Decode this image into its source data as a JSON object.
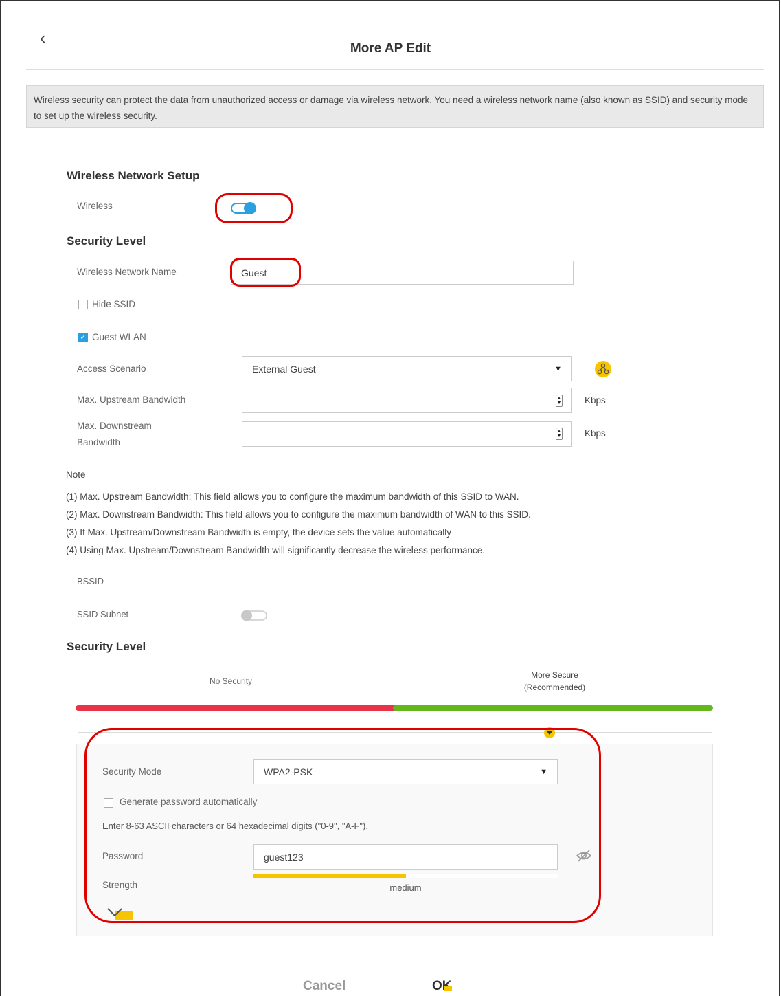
{
  "page": {
    "title": "More AP Edit",
    "back_icon": "chevron-left-icon",
    "info": "Wireless security can protect the data from unauthorized access or damage via wireless network. You need a wireless network name (also known as SSID) and security mode to set up the wireless security."
  },
  "setup": {
    "heading": "Wireless Network Setup",
    "wireless_label": "Wireless",
    "wireless_on": true
  },
  "security1": {
    "heading": "Security Level",
    "ssid_label": "Wireless Network Name",
    "ssid_value": "Guest",
    "hide_ssid_label": "Hide SSID",
    "hide_ssid_checked": false,
    "guest_wlan_label": "Guest WLAN",
    "guest_wlan_checked": true,
    "access_label": "Access Scenario",
    "access_value": "External Guest",
    "up_label": "Max. Upstream Bandwidth",
    "up_value": "",
    "down_label_1": "Max. Downstream",
    "down_label_2": "Bandwidth",
    "down_value": "",
    "unit": "Kbps",
    "scenario_icon": "network-topology-icon"
  },
  "note": {
    "title": "Note",
    "lines": [
      "(1) Max. Upstream Bandwidth: This field allows you to configure the maximum bandwidth of this SSID to WAN.",
      "(2) Max. Downstream Bandwidth: This field allows you to configure the maximum bandwidth of WAN to this SSID.",
      "(3) If Max. Upstream/Downstream Bandwidth is empty, the device sets the value automatically",
      "(4) Using Max. Upstream/Downstream Bandwidth will significantly decrease the wireless performance."
    ]
  },
  "misc": {
    "bssid_label": "BSSID",
    "subnet_label": "SSID Subnet",
    "subnet_on": false
  },
  "security2": {
    "heading": "Security Level",
    "no_security": "No Security",
    "more_secure_1": "More Secure",
    "more_secure_2": "(Recommended)",
    "colors": {
      "low": "#e8334a",
      "high": "#62b81c",
      "handle": "#f7c400"
    },
    "mode_label": "Security Mode",
    "mode_value": "WPA2-PSK",
    "gen_label": "Generate password automatically",
    "gen_checked": false,
    "hint": "Enter 8-63 ASCII characters or 64 hexadecimal digits (\"0-9\", \"A-F\").",
    "pwd_label": "Password",
    "pwd_value": "guest123",
    "eye_icon": "eye-off-icon",
    "strength_label": "Strength",
    "strength_value": "medium",
    "strength_fraction": 0.5
  },
  "buttons": {
    "cancel": "Cancel",
    "ok": "OK"
  }
}
